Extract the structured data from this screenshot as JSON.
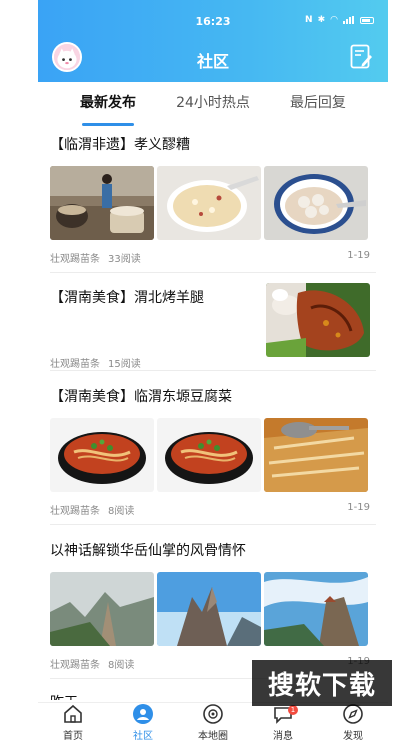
{
  "status": {
    "time": "16:23"
  },
  "header": {
    "title": "社区"
  },
  "tabs": [
    {
      "label": "最新发布"
    },
    {
      "label": "24小时热点"
    },
    {
      "label": "最后回复"
    }
  ],
  "posts": [
    {
      "title": "【临渭非遗】孝义醪糟",
      "author": "壮观踢苗条",
      "reads": "33阅读",
      "date": "1-19"
    },
    {
      "title": "【渭南美食】渭北烤羊腿",
      "author": "壮观踢苗条",
      "reads": "15阅读",
      "date": ""
    },
    {
      "title": "【渭南美食】临渭东塬豆腐菜",
      "author": "壮观踢苗条",
      "reads": "8阅读",
      "date": "1-19"
    },
    {
      "title": "以神话解锁华岳仙掌的风骨情怀",
      "author": "壮观踢苗条",
      "reads": "8阅读",
      "date": "1-19"
    },
    {
      "title": "昨天",
      "author": "",
      "reads": "",
      "date": ""
    }
  ],
  "bottom_nav": [
    {
      "label": "首页",
      "icon": "home-icon"
    },
    {
      "label": "社区",
      "icon": "community-icon"
    },
    {
      "label": "本地圈",
      "icon": "local-circle-icon"
    },
    {
      "label": "消息",
      "icon": "message-icon",
      "badge": "1"
    },
    {
      "label": "发现",
      "icon": "discover-icon"
    }
  ],
  "watermark": "搜软下载",
  "colors": {
    "accent": "#2f8fe8",
    "header_start": "#3aa3f5",
    "header_end": "#53cbef",
    "badge": "#f24b3f"
  }
}
